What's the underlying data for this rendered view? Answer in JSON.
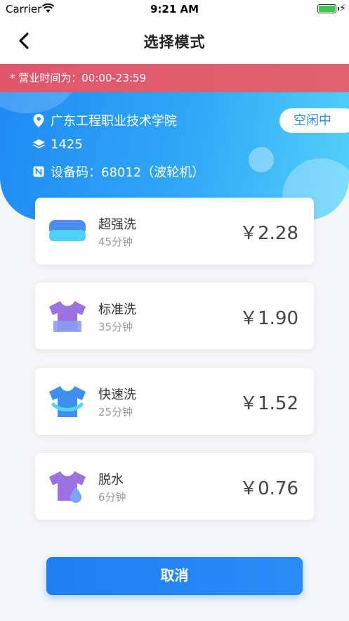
{
  "status_bar": {
    "carrier": "Carrier",
    "time": "9:21 AM"
  },
  "nav": {
    "title": "选择模式"
  },
  "notice": "* 营业时间为：00:00-23:59",
  "location": {
    "name": "广东工程职业技术学院",
    "floor": "1425",
    "device": "设备码：68012（波轮机）",
    "status": "空闲中"
  },
  "modes": [
    {
      "name": "超强洗",
      "duration": "45分钟",
      "price": "￥2.28",
      "icon": "bedding-icon"
    },
    {
      "name": "标准洗",
      "duration": "35分钟",
      "price": "￥1.90",
      "icon": "tshirt-standard-icon"
    },
    {
      "name": "快速洗",
      "duration": "25分钟",
      "price": "￥1.52",
      "icon": "tshirt-quick-icon"
    },
    {
      "name": "脱水",
      "duration": "6分钟",
      "price": "￥0.76",
      "icon": "tshirt-spin-icon"
    }
  ],
  "cancel_label": "取消",
  "colors": {
    "primary": "#1e8af3",
    "notice": "#e0566b",
    "purple": "#9a6fe0"
  }
}
